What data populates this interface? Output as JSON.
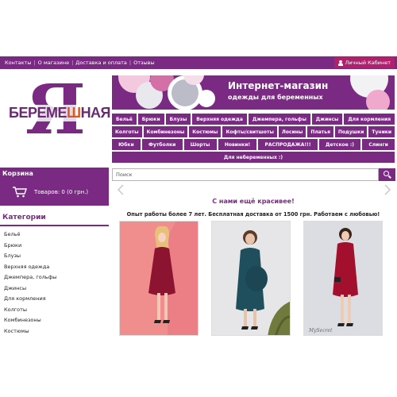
{
  "topnav": {
    "items": [
      "Контакты",
      "О магазине",
      "Доставка и оплата",
      "Отзывы"
    ],
    "cabinet": "Личный Кабинет"
  },
  "logo": {
    "letter": "Я",
    "word_start": "БЕРЕМЕ",
    "word_accent": "Ш",
    "word_end": "НАЯ"
  },
  "banner": {
    "title": "Интернет-магазин",
    "subtitle": "одежды для беременных"
  },
  "categories_nav": {
    "row1": [
      "Бельё",
      "Брюки",
      "Блузы",
      "Верхняя одежда",
      "Джемпера, гольфы",
      "Джинсы",
      "Для кормления"
    ],
    "row2": [
      "Колготы",
      "Комбинезоны",
      "Костюмы",
      "Кофты/свитшоты",
      "Лосины",
      "Платья",
      "Подушки",
      "Туники"
    ],
    "row3": [
      "Юбки",
      "Футболки",
      "Шорты",
      "Новинки!",
      "РАСПРОДАЖА!!!",
      "Детское :)",
      "Слинги"
    ],
    "row4": [
      "Для небеременных :)"
    ]
  },
  "cart": {
    "title": "Корзина",
    "summary": "Товаров: 0 (0 грн.)"
  },
  "search": {
    "placeholder": "Поиск"
  },
  "slogan": "С нами ещё красивее!",
  "info": "Опыт работы более 7 лет. Бесплатная доставка от 1500 грн. Работаем с любовью!",
  "sidebar": {
    "title": "Категории",
    "items": [
      "Бельё",
      "Брюки",
      "Блузы",
      "Верхняя одежда",
      "Джемпера, гольфы",
      "Джинсы",
      "Для кормления",
      "Колготы",
      "Комбинезоны",
      "Костюмы"
    ]
  },
  "products": [
    {
      "bg": "#f08d8d",
      "dress": "#8c1430"
    },
    {
      "bg": "#e6e6e8",
      "dress": "#1f4f5c"
    },
    {
      "bg": "#dcdde3",
      "dress": "#a3102e",
      "watermark": "MySecret"
    }
  ],
  "colors": {
    "brand": "#7b2a84",
    "accent": "#b0206e",
    "logo_accent": "#d85a1e"
  }
}
